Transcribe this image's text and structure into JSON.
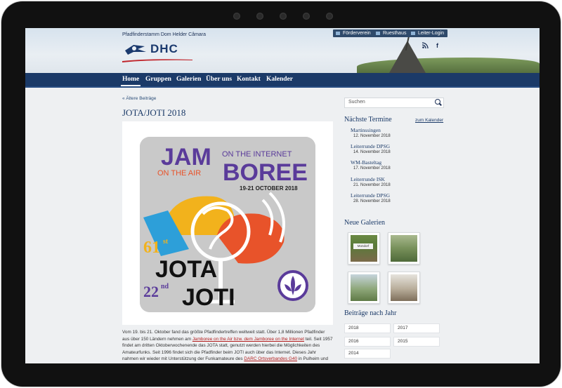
{
  "header": {
    "org_name": "Pfadfinderstamm Dom Helder Câmara",
    "logo_text": "DHC",
    "top_links": [
      "Förderverein",
      "Ruesthaus",
      "Leiter-Login"
    ],
    "social": [
      "rss-icon",
      "facebook-icon"
    ]
  },
  "nav": {
    "items": [
      "Home",
      "Gruppen",
      "Galerien",
      "Über uns",
      "Kontakt",
      "Kalender"
    ],
    "active": "Home"
  },
  "post": {
    "older_link": "« Ältere Beiträge",
    "title": "JOTA/JOTI 2018",
    "poster": {
      "jam": "JAM",
      "boree": "BOREE",
      "on_internet": "ON THE INTERNET",
      "on_air": "ON THE AIR",
      "dates": "19-21 OCTOBER 2018",
      "jota_num": "61",
      "jota_sup": "st",
      "jota": "JOTA",
      "joti_num": "22",
      "joti_sup": "nd",
      "joti": "JOTI"
    },
    "para_1": "Vom 19. bis 21. Oktober fand das größte Pfadfindertreffen weltweit statt. Über 1,8 Millionen Pfadfinder aus über 150 Ländern nehmen am ",
    "para_link_1": "Jamboree on the Air bzw. dem Jamboree on the Internet",
    "para_2": " teil. Seit 1957 findet am dritten Oktoberwochenende das JOTA statt, genutzt werden hierbei die Möglichkeiten des Amateurfunks. Seit 1996 findet sich die Pfadfinder beim JOTI auch über das Internet. Dieses Jahr nahmen wir wieder mit Unterstützung der Funkamateure des ",
    "para_link_2": "DARC Ortsverbandes G40",
    "para_3": " in Pulheim und"
  },
  "sidebar": {
    "search_placeholder": "Suchen",
    "termine_heading": "Nächste Termine",
    "kalender_link": "zum Kalender",
    "events": [
      {
        "title": "Martinssingen",
        "date": "12. November 2018"
      },
      {
        "title": "Leiterrunde DPSG",
        "date": "14. November 2018"
      },
      {
        "title": "WM-Basteltag",
        "date": "17. November 2018"
      },
      {
        "title": "Leiterrunde ISK",
        "date": "21. November 2018"
      },
      {
        "title": "Leiterrunde DPSG",
        "date": "28. November 2018"
      }
    ],
    "galerien_heading": "Neue Galerien",
    "gallery_sign_text": "Mondorf",
    "beitraege_heading": "Beiträge nach Jahr",
    "years": [
      "2018",
      "2017",
      "2016",
      "2015",
      "2014"
    ]
  },
  "colors": {
    "nav_bg": "#1b3a68",
    "link_red": "#b21c1c",
    "heading_blue": "#1b3a68",
    "poster_purple": "#5a3b9a",
    "poster_orange": "#e8532a",
    "poster_yellow": "#f2b21c",
    "poster_blue": "#2d9fd9"
  }
}
